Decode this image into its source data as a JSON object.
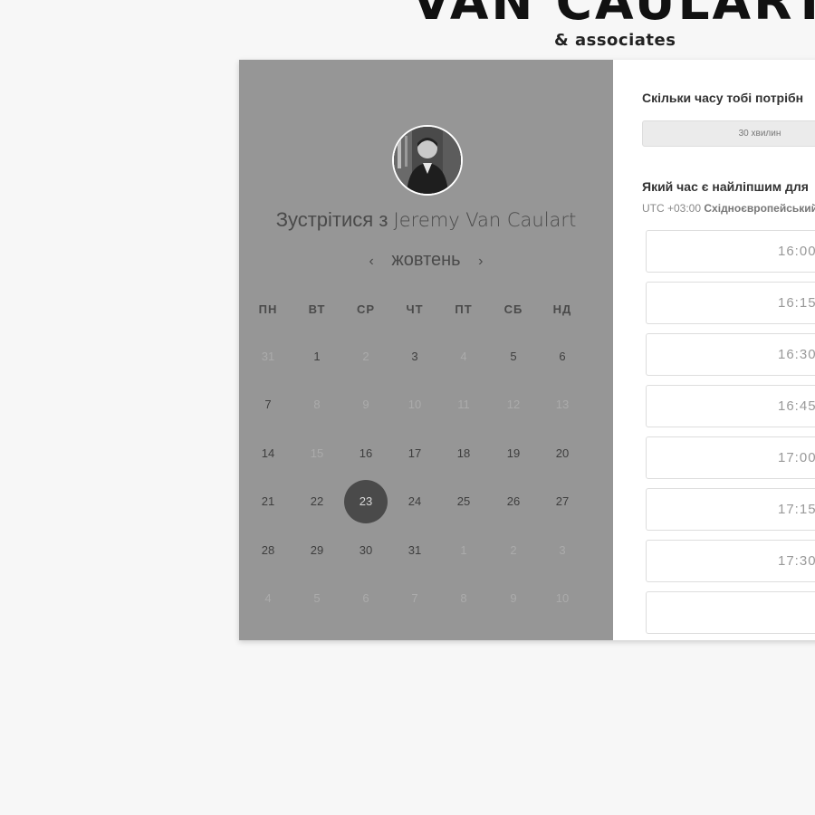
{
  "brand": {
    "title": "VAN CAULART",
    "subtitle": "& associates"
  },
  "left": {
    "title_prefix": "Зустрітися з",
    "host_name": "Jeremy Van Caulart",
    "month": "жовтень",
    "prev_icon": "‹",
    "next_icon": "›",
    "weekdays": [
      "ПН",
      "ВТ",
      "СР",
      "ЧТ",
      "ПТ",
      "СБ",
      "НД"
    ],
    "weeks": [
      [
        {
          "d": "31",
          "s": "muted"
        },
        {
          "d": "1",
          "s": "active"
        },
        {
          "d": "2",
          "s": "muted"
        },
        {
          "d": "3",
          "s": "active"
        },
        {
          "d": "4",
          "s": "muted"
        },
        {
          "d": "5",
          "s": "active"
        },
        {
          "d": "6",
          "s": "active"
        }
      ],
      [
        {
          "d": "7",
          "s": "active"
        },
        {
          "d": "8",
          "s": "muted"
        },
        {
          "d": "9",
          "s": "muted"
        },
        {
          "d": "10",
          "s": "muted"
        },
        {
          "d": "11",
          "s": "muted"
        },
        {
          "d": "12",
          "s": "muted"
        },
        {
          "d": "13",
          "s": "muted"
        }
      ],
      [
        {
          "d": "14",
          "s": "active"
        },
        {
          "d": "15",
          "s": "muted"
        },
        {
          "d": "16",
          "s": "active"
        },
        {
          "d": "17",
          "s": "active"
        },
        {
          "d": "18",
          "s": "active"
        },
        {
          "d": "19",
          "s": "active"
        },
        {
          "d": "20",
          "s": "active"
        }
      ],
      [
        {
          "d": "21",
          "s": "active"
        },
        {
          "d": "22",
          "s": "active"
        },
        {
          "d": "23",
          "s": "selected"
        },
        {
          "d": "24",
          "s": "active"
        },
        {
          "d": "25",
          "s": "active"
        },
        {
          "d": "26",
          "s": "active"
        },
        {
          "d": "27",
          "s": "active"
        }
      ],
      [
        {
          "d": "28",
          "s": "active"
        },
        {
          "d": "29",
          "s": "active"
        },
        {
          "d": "30",
          "s": "active"
        },
        {
          "d": "31",
          "s": "active"
        },
        {
          "d": "1",
          "s": "muted"
        },
        {
          "d": "2",
          "s": "muted"
        },
        {
          "d": "3",
          "s": "muted"
        }
      ],
      [
        {
          "d": "4",
          "s": "muted"
        },
        {
          "d": "5",
          "s": "muted"
        },
        {
          "d": "6",
          "s": "muted"
        },
        {
          "d": "7",
          "s": "muted"
        },
        {
          "d": "8",
          "s": "muted"
        },
        {
          "d": "9",
          "s": "muted"
        },
        {
          "d": "10",
          "s": "muted"
        }
      ]
    ]
  },
  "right": {
    "duration_question": "Скільки часу тобі потрібн",
    "duration_value": "30 хвилин",
    "time_question": "Який час є найліпшим для",
    "tz_offset": "UTC +03:00",
    "tz_name": "Східноєвропейський",
    "slots": [
      "16:00",
      "16:15",
      "16:30",
      "16:45",
      "17:00",
      "17:15",
      "17:30"
    ]
  },
  "colors": {
    "page_bg": "#f7f7f7",
    "left_panel_bg": "#969696",
    "selected_day_bg": "#4a4a4a"
  },
  "icons": [
    "person-avatar",
    "chevron-left-icon",
    "chevron-right-icon"
  ]
}
